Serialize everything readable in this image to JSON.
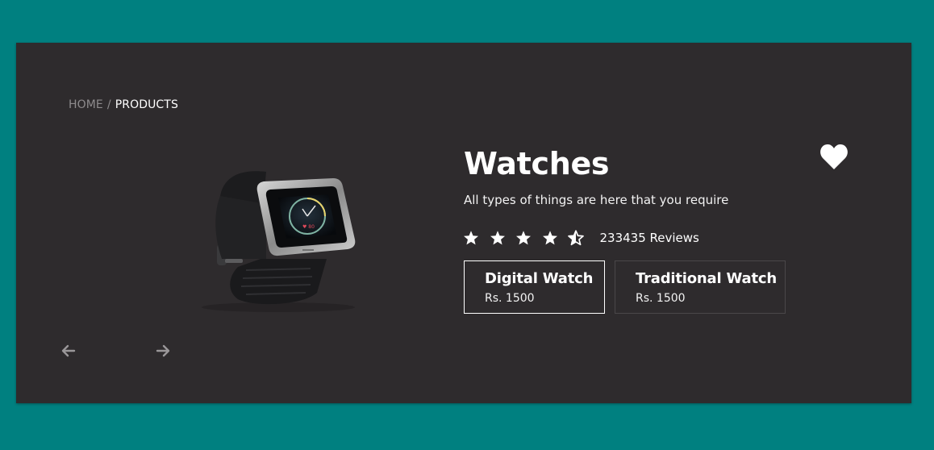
{
  "breadcrumb": {
    "home": "HOME",
    "separator": "/",
    "current": "PRODUCTS"
  },
  "product": {
    "title": "Watches",
    "subtitle": "All types of things are here that you require",
    "image_icon": "fitness-watch-image",
    "favorite_icon": "heart-icon",
    "rating": 4.5,
    "rating_max": 5,
    "reviews": "233435 Reviews"
  },
  "options": [
    {
      "name": "Digital Watch",
      "price": "Rs. 1500",
      "selected": true
    },
    {
      "name": "Traditional Watch",
      "price": "Rs. 1500",
      "selected": false
    }
  ],
  "gallery": {
    "prev_icon": "arrow-left-icon",
    "next_icon": "arrow-right-icon"
  },
  "colors": {
    "page_background": "#008080",
    "card_background": "#2e2b2d",
    "text_primary": "#ffffff",
    "text_muted": "#8e8b8d",
    "selected_border": "#ffffff",
    "unselected_border": "#4a4749"
  }
}
